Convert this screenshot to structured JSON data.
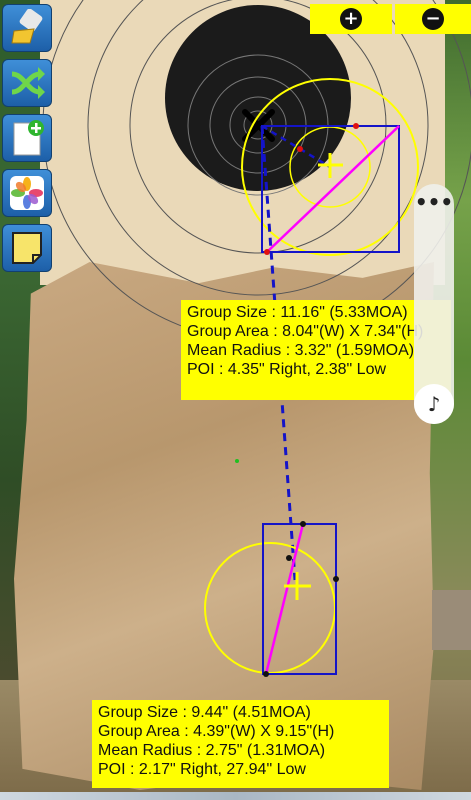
{
  "toolbar": {
    "tools": [
      {
        "name": "clear-tool",
        "icon": "broom-icon"
      },
      {
        "name": "shuffle-tool",
        "icon": "shuffle-icon"
      },
      {
        "name": "new-document-tool",
        "icon": "new-document-icon"
      },
      {
        "name": "photos-tool",
        "icon": "photos-icon"
      },
      {
        "name": "note-tool",
        "icon": "note-icon"
      }
    ]
  },
  "zoom": {
    "plus_label": "+",
    "minus_label": "−"
  },
  "floating_panel": {
    "menu_label": "•••",
    "music_label": "♪"
  },
  "group1": {
    "size": "Group Size : 11.16\" (5.33MOA)",
    "area": "Group Area : 8.04\"(W) X 7.34\"(H)",
    "mean_radius": "Mean Radius : 3.32\" (1.59MOA)",
    "poi": "POI : 4.35\" Right,  2.38\" Low"
  },
  "group2": {
    "size": "Group Size : 9.44\" (4.51MOA)",
    "area": "Group Area : 4.39\"(W) X 9.15\"(H)",
    "mean_radius": "Mean Radius : 2.75\" (1.31MOA)",
    "poi": "POI : 2.17\" Right,  27.94\" Low"
  },
  "colors": {
    "accent_yellow": "#ffff00",
    "bounding_box": "#1414c8",
    "extreme_spread": "#ff00ff",
    "toolbar_blue": "#2a72c0"
  }
}
